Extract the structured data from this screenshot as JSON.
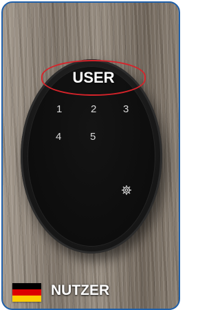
{
  "highlight_label": "USER",
  "keypad": {
    "keys": [
      "1",
      "2",
      "3",
      "4",
      "5"
    ]
  },
  "caption": "NUTZER",
  "icons": {
    "settings": "gear-icon",
    "flag": "german-flag-icon"
  },
  "colors": {
    "frame_border": "#1f5fa8",
    "highlight_ring": "#d6232a",
    "lock_body": "#161616",
    "key_text": "#d8d8d8",
    "flag": [
      "#000000",
      "#dd0000",
      "#ffce00"
    ]
  }
}
